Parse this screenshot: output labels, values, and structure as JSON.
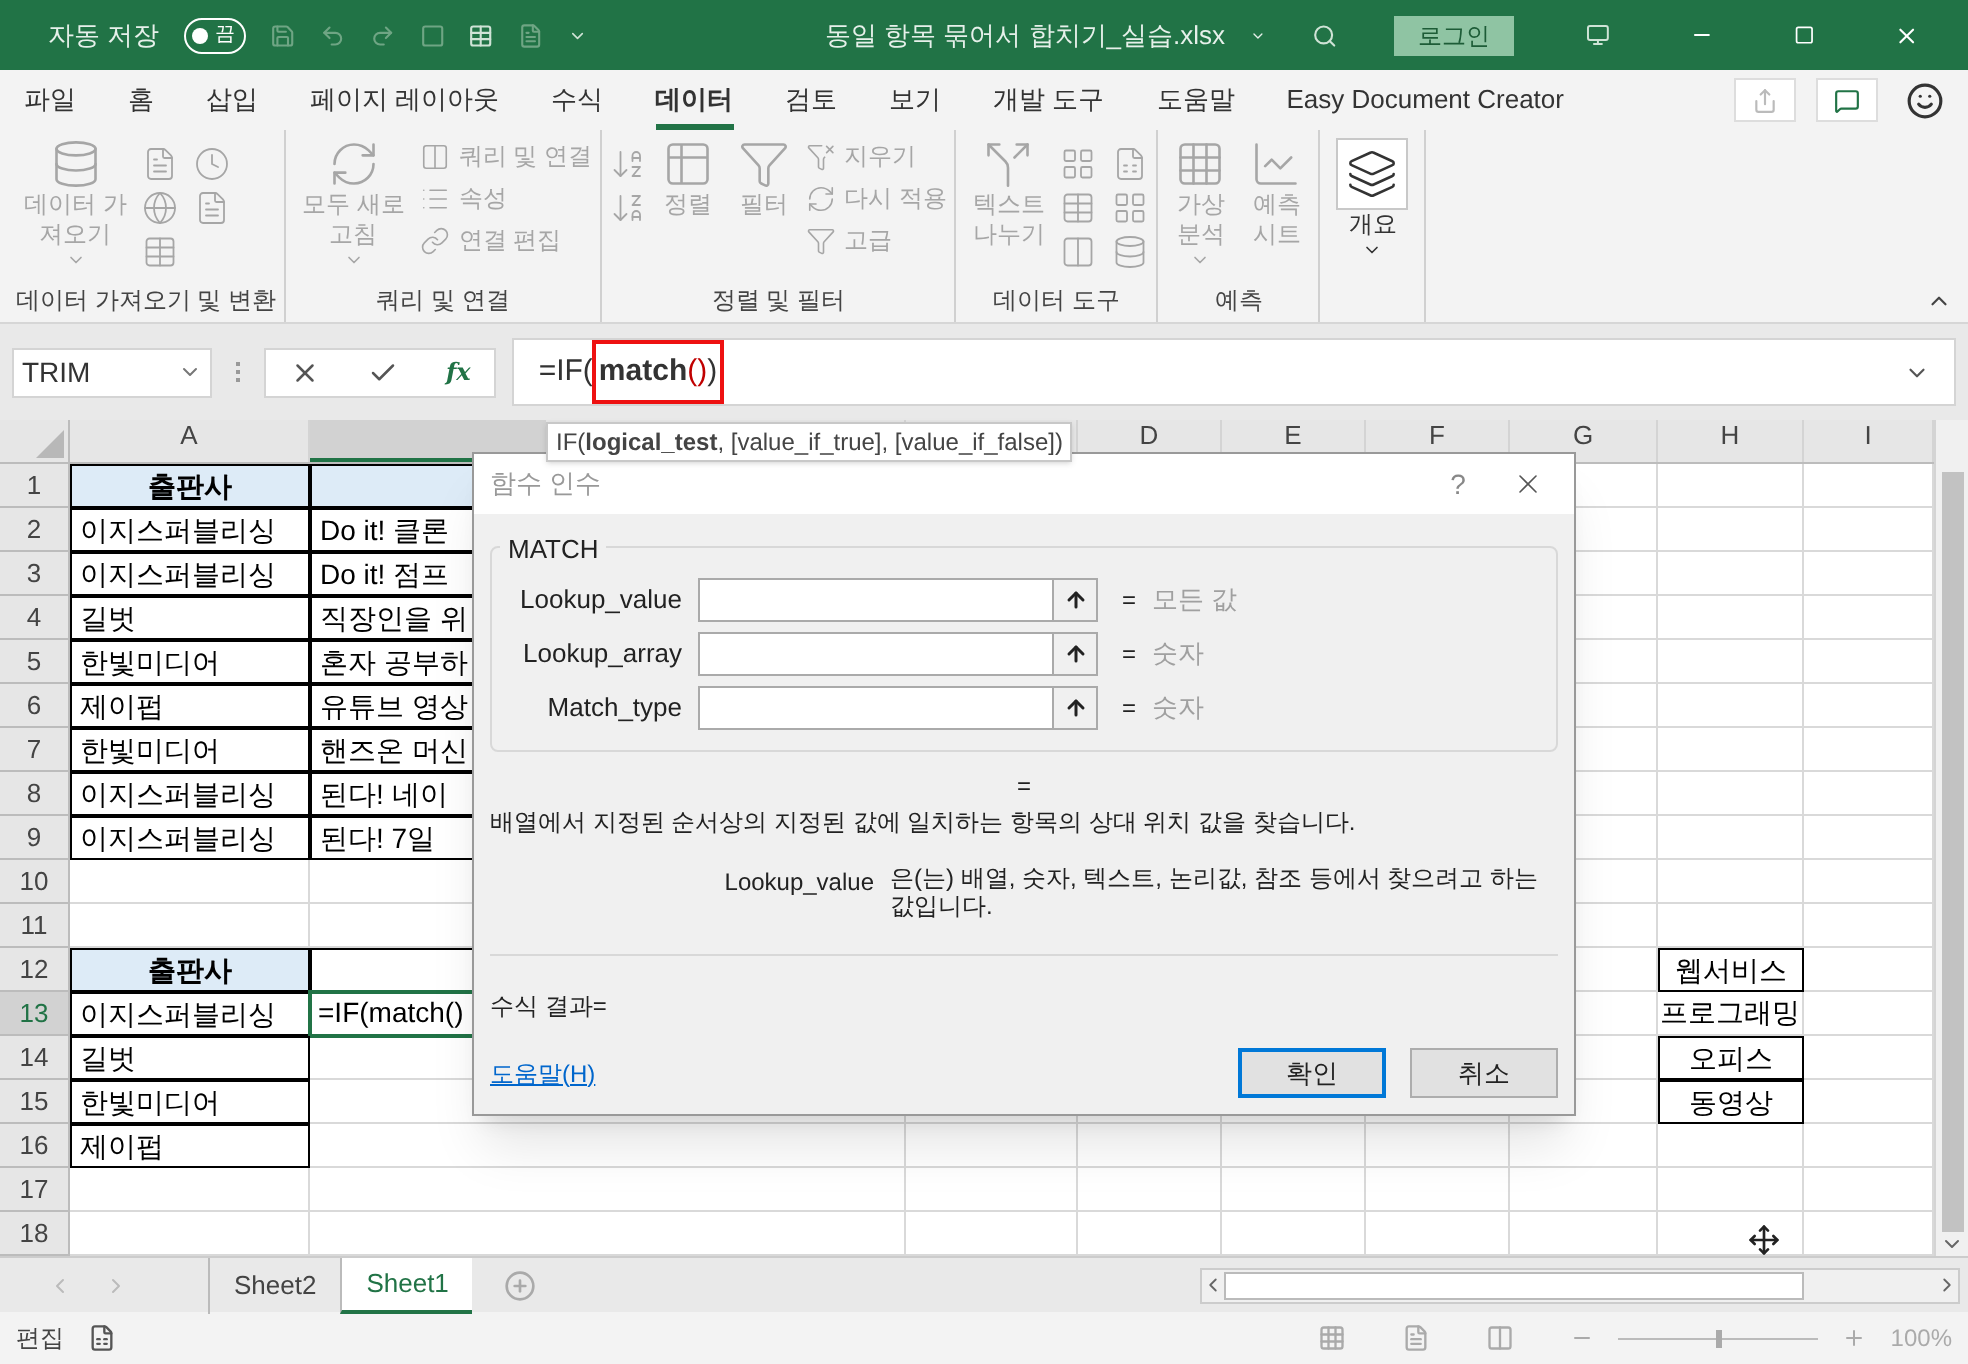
{
  "title_bar": {
    "autosave": {
      "label": "자동 저장",
      "on": false,
      "state_text": "끔"
    },
    "file_name": "동일 항목 묶어서 합치기_실습.xlsx",
    "sign_in": "로그인"
  },
  "menu_tabs": [
    {
      "label": "파일",
      "selected": false
    },
    {
      "label": "홈",
      "selected": false
    },
    {
      "label": "삽입",
      "selected": false
    },
    {
      "label": "페이지 레이아웃",
      "selected": false
    },
    {
      "label": "수식",
      "selected": false
    },
    {
      "label": "데이터",
      "selected": true
    },
    {
      "label": "검토",
      "selected": false
    },
    {
      "label": "보기",
      "selected": false
    },
    {
      "label": "개발 도구",
      "selected": false
    },
    {
      "label": "도움말",
      "selected": false
    },
    {
      "label": "Easy Document Creator",
      "selected": false
    }
  ],
  "ribbon": {
    "groups": [
      {
        "label": "데이터 가져오기 및 변환",
        "items": [
          {
            "kind": "large",
            "lines": [
              "데이터 가",
              "져오기"
            ],
            "dropdown": true,
            "disabled": true
          },
          {
            "kind": "icons"
          }
        ]
      },
      {
        "label": "쿼리 및 연결",
        "items": [
          {
            "kind": "large",
            "lines": [
              "모두 새로",
              "고침"
            ],
            "dropdown": true,
            "disabled": true
          },
          {
            "kind": "small",
            "entries": [
              {
                "label": "쿼리 및 연결",
                "disabled": true
              },
              {
                "label": "속성",
                "disabled": true
              },
              {
                "label": "연결 편집",
                "disabled": true
              }
            ]
          }
        ]
      },
      {
        "label": "정렬 및 필터",
        "items": [
          {
            "kind": "icons"
          },
          {
            "kind": "large",
            "lines": [
              "정렬"
            ],
            "dropdown": false,
            "disabled": true
          },
          {
            "kind": "large",
            "lines": [
              "필터"
            ],
            "dropdown": false,
            "disabled": true
          },
          {
            "kind": "small",
            "entries": [
              {
                "label": "지우기",
                "disabled": true
              },
              {
                "label": "다시 적용",
                "disabled": true
              },
              {
                "label": "고급",
                "disabled": true
              }
            ]
          }
        ]
      },
      {
        "label": "데이터 도구",
        "items": [
          {
            "kind": "large",
            "lines": [
              "텍스트",
              "나누기"
            ],
            "dropdown": false,
            "disabled": true
          },
          {
            "kind": "icons"
          }
        ]
      },
      {
        "label": "예측",
        "items": [
          {
            "kind": "large",
            "lines": [
              "가상",
              "분석"
            ],
            "dropdown": true,
            "disabled": true
          },
          {
            "kind": "large",
            "lines": [
              "예측",
              "시트"
            ],
            "dropdown": false,
            "disabled": true
          }
        ]
      },
      {
        "items": [
          {
            "kind": "large",
            "lines": [
              "개요"
            ],
            "dropdown": true,
            "disabled": false
          }
        ]
      }
    ]
  },
  "formula_bar": {
    "name_box": "TRIM",
    "function_button": "fx",
    "parts": [
      {
        "text": "=IF("
      }
    ],
    "highlighted_parts": [
      {
        "text": "match",
        "kind": "bold"
      },
      {
        "text": "()",
        "kind": "paren"
      },
      {
        "text": ")"
      }
    ]
  },
  "tooltip": "IF(**logical_test**, [value_if_true], [value_if_false])",
  "sheet": {
    "columns": [
      {
        "label": "A",
        "selected": false
      },
      {
        "selected": true
      },
      {
        "selected": false
      },
      {
        "label": "D",
        "selected": false
      },
      {
        "label": "E",
        "selected": false
      },
      {
        "label": "F",
        "selected": false
      },
      {
        "label": "G",
        "selected": false
      },
      {
        "label": "H",
        "selected": false
      },
      {
        "label": "I",
        "selected": false
      }
    ],
    "rows": [
      {
        "number": "1",
        "cells": {
          "A": {
            "text": "출판사",
            "kind": "header"
          },
          "B": {
            "kind": "header"
          }
        }
      },
      {
        "number": "2",
        "cells": {
          "A": {
            "text": "이지스퍼블리싱",
            "kind": "boxed"
          },
          "B": {
            "text": "Do it! 클론",
            "kind": "boxed"
          }
        }
      },
      {
        "number": "3",
        "cells": {
          "A": {
            "text": "이지스퍼블리싱",
            "kind": "boxed"
          },
          "B": {
            "text": "Do it! 점프",
            "kind": "boxed"
          }
        }
      },
      {
        "number": "4",
        "cells": {
          "A": {
            "text": "길벗",
            "kind": "boxed"
          },
          "B": {
            "text": "직장인을 위",
            "kind": "boxed"
          }
        }
      },
      {
        "number": "5",
        "cells": {
          "A": {
            "text": "한빛미디어",
            "kind": "boxed"
          },
          "B": {
            "text": "혼자 공부하",
            "kind": "boxed"
          }
        }
      },
      {
        "number": "6",
        "cells": {
          "A": {
            "text": "제이펍",
            "kind": "boxed"
          },
          "B": {
            "text": "유튜브 영상",
            "kind": "boxed"
          }
        }
      },
      {
        "number": "7",
        "cells": {
          "A": {
            "text": "한빛미디어",
            "kind": "boxed"
          },
          "B": {
            "text": "핸즈온 머신",
            "kind": "boxed"
          }
        }
      },
      {
        "number": "8",
        "cells": {
          "A": {
            "text": "이지스퍼블리싱",
            "kind": "boxed"
          },
          "B": {
            "text": "된다! 네이",
            "kind": "boxed"
          }
        }
      },
      {
        "number": "9",
        "cells": {
          "A": {
            "text": "이지스퍼블리싱",
            "kind": "boxed"
          },
          "B": {
            "text": "된다! 7일",
            "kind": "boxed"
          }
        }
      },
      {
        "number": "10",
        "cells": {}
      },
      {
        "number": "11",
        "cells": {}
      },
      {
        "number": "12",
        "cells": {
          "A": {
            "text": "출판사",
            "kind": "header"
          },
          "B": {
            "kind": "boxed"
          },
          "H": {
            "text": "웹서비스",
            "kind": "boxed"
          }
        }
      },
      {
        "number": "13",
        "cells": {
          "A": {
            "text": "이지스퍼블리싱",
            "kind": "boxed"
          },
          "B": {
            "text": "=IF(match()",
            "kind": "plain",
            "selected": true
          },
          "H": {
            "text": "프로그래밍",
            "kind": "plain"
          }
        }
      },
      {
        "number": "14",
        "cells": {
          "A": {
            "text": "길벗",
            "kind": "boxed"
          },
          "H": {
            "text": "오피스",
            "kind": "boxed"
          }
        }
      },
      {
        "number": "15",
        "cells": {
          "A": {
            "text": "한빛미디어",
            "kind": "boxed"
          },
          "H": {
            "text": "동영상",
            "kind": "boxed"
          }
        }
      },
      {
        "number": "16",
        "cells": {
          "A": {
            "text": "제이펍",
            "kind": "boxed"
          }
        }
      },
      {
        "number": "17",
        "cells": {}
      },
      {
        "number": "18",
        "cells": {}
      }
    ]
  },
  "dialog": {
    "title": "함수 인수",
    "help_mark": "?",
    "function_name": "MATCH",
    "arguments": [
      {
        "name": "Lookup_value",
        "result": "모든 값"
      },
      {
        "name": "Lookup_array",
        "result": "숫자"
      },
      {
        "name": "Match_type",
        "result": "숫자"
      }
    ],
    "equals": "=",
    "result_equals": "=",
    "description": "배열에서 지정된 순서상의 지정된 값에 일치하는 항목의 상대 위치 값을 찾습니다.",
    "argument_help": {
      "name": "Lookup_value",
      "text": "은(는) 배열, 숫자, 텍스트, 논리값, 참조 등에서 찾으려고 하는 값입니다."
    },
    "formula_result": "수식 결과=",
    "help_link": "도움말(H)",
    "buttons": [
      {
        "label": "확인",
        "default": true
      },
      {
        "label": "취소",
        "default": false
      }
    ]
  },
  "sheet_tabs": [
    {
      "label": "Sheet2",
      "selected": false
    },
    {
      "label": "Sheet1",
      "selected": true
    }
  ],
  "status_bar": {
    "mode": "편집",
    "zoom": {
      "level": 0.5,
      "reading": "100%"
    }
  }
}
